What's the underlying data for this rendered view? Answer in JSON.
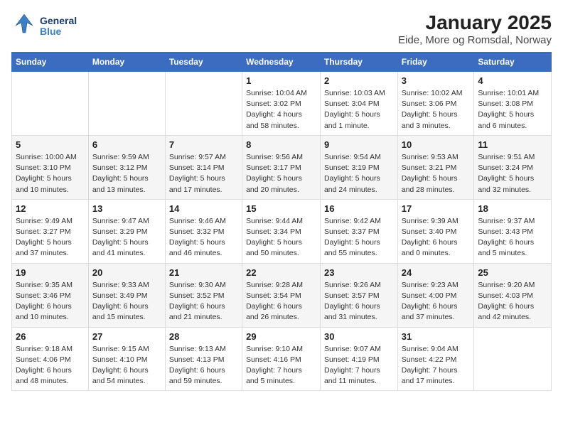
{
  "header": {
    "logo_general": "General",
    "logo_blue": "Blue",
    "title": "January 2025",
    "subtitle": "Eide, More og Romsdal, Norway"
  },
  "weekdays": [
    "Sunday",
    "Monday",
    "Tuesday",
    "Wednesday",
    "Thursday",
    "Friday",
    "Saturday"
  ],
  "weeks": [
    [
      {
        "day": "",
        "detail": ""
      },
      {
        "day": "",
        "detail": ""
      },
      {
        "day": "",
        "detail": ""
      },
      {
        "day": "1",
        "detail": "Sunrise: 10:04 AM\nSunset: 3:02 PM\nDaylight: 4 hours\nand 58 minutes."
      },
      {
        "day": "2",
        "detail": "Sunrise: 10:03 AM\nSunset: 3:04 PM\nDaylight: 5 hours\nand 1 minute."
      },
      {
        "day": "3",
        "detail": "Sunrise: 10:02 AM\nSunset: 3:06 PM\nDaylight: 5 hours\nand 3 minutes."
      },
      {
        "day": "4",
        "detail": "Sunrise: 10:01 AM\nSunset: 3:08 PM\nDaylight: 5 hours\nand 6 minutes."
      }
    ],
    [
      {
        "day": "5",
        "detail": "Sunrise: 10:00 AM\nSunset: 3:10 PM\nDaylight: 5 hours\nand 10 minutes."
      },
      {
        "day": "6",
        "detail": "Sunrise: 9:59 AM\nSunset: 3:12 PM\nDaylight: 5 hours\nand 13 minutes."
      },
      {
        "day": "7",
        "detail": "Sunrise: 9:57 AM\nSunset: 3:14 PM\nDaylight: 5 hours\nand 17 minutes."
      },
      {
        "day": "8",
        "detail": "Sunrise: 9:56 AM\nSunset: 3:17 PM\nDaylight: 5 hours\nand 20 minutes."
      },
      {
        "day": "9",
        "detail": "Sunrise: 9:54 AM\nSunset: 3:19 PM\nDaylight: 5 hours\nand 24 minutes."
      },
      {
        "day": "10",
        "detail": "Sunrise: 9:53 AM\nSunset: 3:21 PM\nDaylight: 5 hours\nand 28 minutes."
      },
      {
        "day": "11",
        "detail": "Sunrise: 9:51 AM\nSunset: 3:24 PM\nDaylight: 5 hours\nand 32 minutes."
      }
    ],
    [
      {
        "day": "12",
        "detail": "Sunrise: 9:49 AM\nSunset: 3:27 PM\nDaylight: 5 hours\nand 37 minutes."
      },
      {
        "day": "13",
        "detail": "Sunrise: 9:47 AM\nSunset: 3:29 PM\nDaylight: 5 hours\nand 41 minutes."
      },
      {
        "day": "14",
        "detail": "Sunrise: 9:46 AM\nSunset: 3:32 PM\nDaylight: 5 hours\nand 46 minutes."
      },
      {
        "day": "15",
        "detail": "Sunrise: 9:44 AM\nSunset: 3:34 PM\nDaylight: 5 hours\nand 50 minutes."
      },
      {
        "day": "16",
        "detail": "Sunrise: 9:42 AM\nSunset: 3:37 PM\nDaylight: 5 hours\nand 55 minutes."
      },
      {
        "day": "17",
        "detail": "Sunrise: 9:39 AM\nSunset: 3:40 PM\nDaylight: 6 hours\nand 0 minutes."
      },
      {
        "day": "18",
        "detail": "Sunrise: 9:37 AM\nSunset: 3:43 PM\nDaylight: 6 hours\nand 5 minutes."
      }
    ],
    [
      {
        "day": "19",
        "detail": "Sunrise: 9:35 AM\nSunset: 3:46 PM\nDaylight: 6 hours\nand 10 minutes."
      },
      {
        "day": "20",
        "detail": "Sunrise: 9:33 AM\nSunset: 3:49 PM\nDaylight: 6 hours\nand 15 minutes."
      },
      {
        "day": "21",
        "detail": "Sunrise: 9:30 AM\nSunset: 3:52 PM\nDaylight: 6 hours\nand 21 minutes."
      },
      {
        "day": "22",
        "detail": "Sunrise: 9:28 AM\nSunset: 3:54 PM\nDaylight: 6 hours\nand 26 minutes."
      },
      {
        "day": "23",
        "detail": "Sunrise: 9:26 AM\nSunset: 3:57 PM\nDaylight: 6 hours\nand 31 minutes."
      },
      {
        "day": "24",
        "detail": "Sunrise: 9:23 AM\nSunset: 4:00 PM\nDaylight: 6 hours\nand 37 minutes."
      },
      {
        "day": "25",
        "detail": "Sunrise: 9:20 AM\nSunset: 4:03 PM\nDaylight: 6 hours\nand 42 minutes."
      }
    ],
    [
      {
        "day": "26",
        "detail": "Sunrise: 9:18 AM\nSunset: 4:06 PM\nDaylight: 6 hours\nand 48 minutes."
      },
      {
        "day": "27",
        "detail": "Sunrise: 9:15 AM\nSunset: 4:10 PM\nDaylight: 6 hours\nand 54 minutes."
      },
      {
        "day": "28",
        "detail": "Sunrise: 9:13 AM\nSunset: 4:13 PM\nDaylight: 6 hours\nand 59 minutes."
      },
      {
        "day": "29",
        "detail": "Sunrise: 9:10 AM\nSunset: 4:16 PM\nDaylight: 7 hours\nand 5 minutes."
      },
      {
        "day": "30",
        "detail": "Sunrise: 9:07 AM\nSunset: 4:19 PM\nDaylight: 7 hours\nand 11 minutes."
      },
      {
        "day": "31",
        "detail": "Sunrise: 9:04 AM\nSunset: 4:22 PM\nDaylight: 7 hours\nand 17 minutes."
      },
      {
        "day": "",
        "detail": ""
      }
    ]
  ]
}
